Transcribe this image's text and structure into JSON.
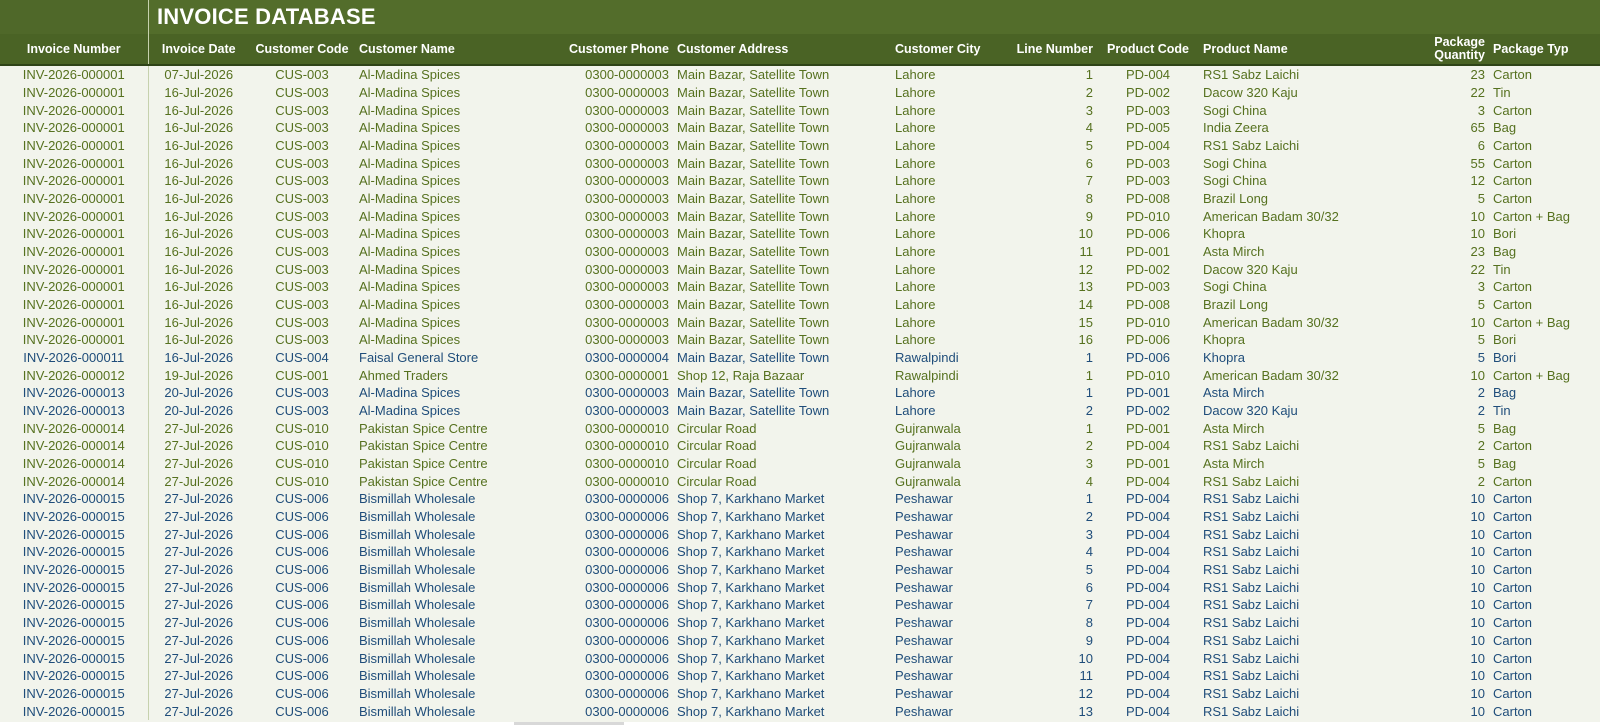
{
  "sheet": {
    "title": "INVOICE DATABASE"
  },
  "colors": {
    "header_bg": "#4a6325",
    "title_bg": "#536d2b",
    "row_green": "#56711f",
    "row_blue": "#1f4d7a",
    "sheet_bg": "#f2f4ec"
  },
  "columns": [
    "Invoice Number",
    "Invoice Date",
    "Customer Code",
    "Customer Name",
    "Customer Phone",
    "Customer Address",
    "Customer City",
    "Line Number",
    "Product Code",
    "Product Name",
    "Package Quantity",
    "Package Typ"
  ],
  "rows": [
    {
      "inv": "INV-2026-000001",
      "date": "07-Jul-2026",
      "code": "CUS-003",
      "name": "Al-Madina Spices",
      "phone": "0300-0000003",
      "address": "Main Bazar, Satellite Town",
      "city": "Lahore",
      "line": "1",
      "pcode": "PD-004",
      "pname": "RS1 Sabz Laichi",
      "qty": "23",
      "ptype": "Carton",
      "color": "green"
    },
    {
      "inv": "INV-2026-000001",
      "date": "16-Jul-2026",
      "code": "CUS-003",
      "name": "Al-Madina Spices",
      "phone": "0300-0000003",
      "address": "Main Bazar, Satellite Town",
      "city": "Lahore",
      "line": "2",
      "pcode": "PD-002",
      "pname": "Dacow 320 Kaju",
      "qty": "22",
      "ptype": "Tin",
      "color": "green"
    },
    {
      "inv": "INV-2026-000001",
      "date": "16-Jul-2026",
      "code": "CUS-003",
      "name": "Al-Madina Spices",
      "phone": "0300-0000003",
      "address": "Main Bazar, Satellite Town",
      "city": "Lahore",
      "line": "3",
      "pcode": "PD-003",
      "pname": "Sogi China",
      "qty": "3",
      "ptype": "Carton",
      "color": "green"
    },
    {
      "inv": "INV-2026-000001",
      "date": "16-Jul-2026",
      "code": "CUS-003",
      "name": "Al-Madina Spices",
      "phone": "0300-0000003",
      "address": "Main Bazar, Satellite Town",
      "city": "Lahore",
      "line": "4",
      "pcode": "PD-005",
      "pname": "India Zeera",
      "qty": "65",
      "ptype": "Bag",
      "color": "green"
    },
    {
      "inv": "INV-2026-000001",
      "date": "16-Jul-2026",
      "code": "CUS-003",
      "name": "Al-Madina Spices",
      "phone": "0300-0000003",
      "address": "Main Bazar, Satellite Town",
      "city": "Lahore",
      "line": "5",
      "pcode": "PD-004",
      "pname": "RS1 Sabz Laichi",
      "qty": "6",
      "ptype": "Carton",
      "color": "green"
    },
    {
      "inv": "INV-2026-000001",
      "date": "16-Jul-2026",
      "code": "CUS-003",
      "name": "Al-Madina Spices",
      "phone": "0300-0000003",
      "address": "Main Bazar, Satellite Town",
      "city": "Lahore",
      "line": "6",
      "pcode": "PD-003",
      "pname": "Sogi China",
      "qty": "55",
      "ptype": "Carton",
      "color": "green"
    },
    {
      "inv": "INV-2026-000001",
      "date": "16-Jul-2026",
      "code": "CUS-003",
      "name": "Al-Madina Spices",
      "phone": "0300-0000003",
      "address": "Main Bazar, Satellite Town",
      "city": "Lahore",
      "line": "7",
      "pcode": "PD-003",
      "pname": "Sogi China",
      "qty": "12",
      "ptype": "Carton",
      "color": "green"
    },
    {
      "inv": "INV-2026-000001",
      "date": "16-Jul-2026",
      "code": "CUS-003",
      "name": "Al-Madina Spices",
      "phone": "0300-0000003",
      "address": "Main Bazar, Satellite Town",
      "city": "Lahore",
      "line": "8",
      "pcode": "PD-008",
      "pname": "Brazil Long",
      "qty": "5",
      "ptype": "Carton",
      "color": "green"
    },
    {
      "inv": "INV-2026-000001",
      "date": "16-Jul-2026",
      "code": "CUS-003",
      "name": "Al-Madina Spices",
      "phone": "0300-0000003",
      "address": "Main Bazar, Satellite Town",
      "city": "Lahore",
      "line": "9",
      "pcode": "PD-010",
      "pname": "American Badam 30/32",
      "qty": "10",
      "ptype": "Carton + Bag",
      "color": "green"
    },
    {
      "inv": "INV-2026-000001",
      "date": "16-Jul-2026",
      "code": "CUS-003",
      "name": "Al-Madina Spices",
      "phone": "0300-0000003",
      "address": "Main Bazar, Satellite Town",
      "city": "Lahore",
      "line": "10",
      "pcode": "PD-006",
      "pname": "Khopra",
      "qty": "10",
      "ptype": "Bori",
      "color": "green"
    },
    {
      "inv": "INV-2026-000001",
      "date": "16-Jul-2026",
      "code": "CUS-003",
      "name": "Al-Madina Spices",
      "phone": "0300-0000003",
      "address": "Main Bazar, Satellite Town",
      "city": "Lahore",
      "line": "11",
      "pcode": "PD-001",
      "pname": "Asta Mirch",
      "qty": "23",
      "ptype": "Bag",
      "color": "green"
    },
    {
      "inv": "INV-2026-000001",
      "date": "16-Jul-2026",
      "code": "CUS-003",
      "name": "Al-Madina Spices",
      "phone": "0300-0000003",
      "address": "Main Bazar, Satellite Town",
      "city": "Lahore",
      "line": "12",
      "pcode": "PD-002",
      "pname": "Dacow 320 Kaju",
      "qty": "22",
      "ptype": "Tin",
      "color": "green"
    },
    {
      "inv": "INV-2026-000001",
      "date": "16-Jul-2026",
      "code": "CUS-003",
      "name": "Al-Madina Spices",
      "phone": "0300-0000003",
      "address": "Main Bazar, Satellite Town",
      "city": "Lahore",
      "line": "13",
      "pcode": "PD-003",
      "pname": "Sogi China",
      "qty": "3",
      "ptype": "Carton",
      "color": "green"
    },
    {
      "inv": "INV-2026-000001",
      "date": "16-Jul-2026",
      "code": "CUS-003",
      "name": "Al-Madina Spices",
      "phone": "0300-0000003",
      "address": "Main Bazar, Satellite Town",
      "city": "Lahore",
      "line": "14",
      "pcode": "PD-008",
      "pname": "Brazil Long",
      "qty": "5",
      "ptype": "Carton",
      "color": "green"
    },
    {
      "inv": "INV-2026-000001",
      "date": "16-Jul-2026",
      "code": "CUS-003",
      "name": "Al-Madina Spices",
      "phone": "0300-0000003",
      "address": "Main Bazar, Satellite Town",
      "city": "Lahore",
      "line": "15",
      "pcode": "PD-010",
      "pname": "American Badam 30/32",
      "qty": "10",
      "ptype": "Carton + Bag",
      "color": "green"
    },
    {
      "inv": "INV-2026-000001",
      "date": "16-Jul-2026",
      "code": "CUS-003",
      "name": "Al-Madina Spices",
      "phone": "0300-0000003",
      "address": "Main Bazar, Satellite Town",
      "city": "Lahore",
      "line": "16",
      "pcode": "PD-006",
      "pname": "Khopra",
      "qty": "5",
      "ptype": "Bori",
      "color": "green"
    },
    {
      "inv": "INV-2026-000011",
      "date": "16-Jul-2026",
      "code": "CUS-004",
      "name": "Faisal General Store",
      "phone": "0300-0000004",
      "address": "Main Bazar, Satellite Town",
      "city": "Rawalpindi",
      "line": "1",
      "pcode": "PD-006",
      "pname": "Khopra",
      "qty": "5",
      "ptype": "Bori",
      "color": "blue"
    },
    {
      "inv": "INV-2026-000012",
      "date": "19-Jul-2026",
      "code": "CUS-001",
      "name": "Ahmed Traders",
      "phone": "0300-0000001",
      "address": "Shop 12, Raja Bazaar",
      "city": "Rawalpindi",
      "line": "1",
      "pcode": "PD-010",
      "pname": "American Badam 30/32",
      "qty": "10",
      "ptype": "Carton + Bag",
      "color": "green"
    },
    {
      "inv": "INV-2026-000013",
      "date": "20-Jul-2026",
      "code": "CUS-003",
      "name": "Al-Madina Spices",
      "phone": "0300-0000003",
      "address": "Main Bazar, Satellite Town",
      "city": "Lahore",
      "line": "1",
      "pcode": "PD-001",
      "pname": "Asta Mirch",
      "qty": "2",
      "ptype": "Bag",
      "color": "blue"
    },
    {
      "inv": "INV-2026-000013",
      "date": "20-Jul-2026",
      "code": "CUS-003",
      "name": "Al-Madina Spices",
      "phone": "0300-0000003",
      "address": "Main Bazar, Satellite Town",
      "city": "Lahore",
      "line": "2",
      "pcode": "PD-002",
      "pname": "Dacow 320 Kaju",
      "qty": "2",
      "ptype": "Tin",
      "color": "blue"
    },
    {
      "inv": "INV-2026-000014",
      "date": "27-Jul-2026",
      "code": "CUS-010",
      "name": "Pakistan Spice Centre",
      "phone": "0300-0000010",
      "address": "Circular Road",
      "city": "Gujranwala",
      "line": "1",
      "pcode": "PD-001",
      "pname": "Asta Mirch",
      "qty": "5",
      "ptype": "Bag",
      "color": "green"
    },
    {
      "inv": "INV-2026-000014",
      "date": "27-Jul-2026",
      "code": "CUS-010",
      "name": "Pakistan Spice Centre",
      "phone": "0300-0000010",
      "address": "Circular Road",
      "city": "Gujranwala",
      "line": "2",
      "pcode": "PD-004",
      "pname": "RS1 Sabz Laichi",
      "qty": "2",
      "ptype": "Carton",
      "color": "green"
    },
    {
      "inv": "INV-2026-000014",
      "date": "27-Jul-2026",
      "code": "CUS-010",
      "name": "Pakistan Spice Centre",
      "phone": "0300-0000010",
      "address": "Circular Road",
      "city": "Gujranwala",
      "line": "3",
      "pcode": "PD-001",
      "pname": "Asta Mirch",
      "qty": "5",
      "ptype": "Bag",
      "color": "green"
    },
    {
      "inv": "INV-2026-000014",
      "date": "27-Jul-2026",
      "code": "CUS-010",
      "name": "Pakistan Spice Centre",
      "phone": "0300-0000010",
      "address": "Circular Road",
      "city": "Gujranwala",
      "line": "4",
      "pcode": "PD-004",
      "pname": "RS1 Sabz Laichi",
      "qty": "2",
      "ptype": "Carton",
      "color": "green"
    },
    {
      "inv": "INV-2026-000015",
      "date": "27-Jul-2026",
      "code": "CUS-006",
      "name": "Bismillah Wholesale",
      "phone": "0300-0000006",
      "address": "Shop 7, Karkhano Market",
      "city": "Peshawar",
      "line": "1",
      "pcode": "PD-004",
      "pname": "RS1 Sabz Laichi",
      "qty": "10",
      "ptype": "Carton",
      "color": "blue"
    },
    {
      "inv": "INV-2026-000015",
      "date": "27-Jul-2026",
      "code": "CUS-006",
      "name": "Bismillah Wholesale",
      "phone": "0300-0000006",
      "address": "Shop 7, Karkhano Market",
      "city": "Peshawar",
      "line": "2",
      "pcode": "PD-004",
      "pname": "RS1 Sabz Laichi",
      "qty": "10",
      "ptype": "Carton",
      "color": "blue"
    },
    {
      "inv": "INV-2026-000015",
      "date": "27-Jul-2026",
      "code": "CUS-006",
      "name": "Bismillah Wholesale",
      "phone": "0300-0000006",
      "address": "Shop 7, Karkhano Market",
      "city": "Peshawar",
      "line": "3",
      "pcode": "PD-004",
      "pname": "RS1 Sabz Laichi",
      "qty": "10",
      "ptype": "Carton",
      "color": "blue"
    },
    {
      "inv": "INV-2026-000015",
      "date": "27-Jul-2026",
      "code": "CUS-006",
      "name": "Bismillah Wholesale",
      "phone": "0300-0000006",
      "address": "Shop 7, Karkhano Market",
      "city": "Peshawar",
      "line": "4",
      "pcode": "PD-004",
      "pname": "RS1 Sabz Laichi",
      "qty": "10",
      "ptype": "Carton",
      "color": "blue"
    },
    {
      "inv": "INV-2026-000015",
      "date": "27-Jul-2026",
      "code": "CUS-006",
      "name": "Bismillah Wholesale",
      "phone": "0300-0000006",
      "address": "Shop 7, Karkhano Market",
      "city": "Peshawar",
      "line": "5",
      "pcode": "PD-004",
      "pname": "RS1 Sabz Laichi",
      "qty": "10",
      "ptype": "Carton",
      "color": "blue"
    },
    {
      "inv": "INV-2026-000015",
      "date": "27-Jul-2026",
      "code": "CUS-006",
      "name": "Bismillah Wholesale",
      "phone": "0300-0000006",
      "address": "Shop 7, Karkhano Market",
      "city": "Peshawar",
      "line": "6",
      "pcode": "PD-004",
      "pname": "RS1 Sabz Laichi",
      "qty": "10",
      "ptype": "Carton",
      "color": "blue"
    },
    {
      "inv": "INV-2026-000015",
      "date": "27-Jul-2026",
      "code": "CUS-006",
      "name": "Bismillah Wholesale",
      "phone": "0300-0000006",
      "address": "Shop 7, Karkhano Market",
      "city": "Peshawar",
      "line": "7",
      "pcode": "PD-004",
      "pname": "RS1 Sabz Laichi",
      "qty": "10",
      "ptype": "Carton",
      "color": "blue"
    },
    {
      "inv": "INV-2026-000015",
      "date": "27-Jul-2026",
      "code": "CUS-006",
      "name": "Bismillah Wholesale",
      "phone": "0300-0000006",
      "address": "Shop 7, Karkhano Market",
      "city": "Peshawar",
      "line": "8",
      "pcode": "PD-004",
      "pname": "RS1 Sabz Laichi",
      "qty": "10",
      "ptype": "Carton",
      "color": "blue"
    },
    {
      "inv": "INV-2026-000015",
      "date": "27-Jul-2026",
      "code": "CUS-006",
      "name": "Bismillah Wholesale",
      "phone": "0300-0000006",
      "address": "Shop 7, Karkhano Market",
      "city": "Peshawar",
      "line": "9",
      "pcode": "PD-004",
      "pname": "RS1 Sabz Laichi",
      "qty": "10",
      "ptype": "Carton",
      "color": "blue"
    },
    {
      "inv": "INV-2026-000015",
      "date": "27-Jul-2026",
      "code": "CUS-006",
      "name": "Bismillah Wholesale",
      "phone": "0300-0000006",
      "address": "Shop 7, Karkhano Market",
      "city": "Peshawar",
      "line": "10",
      "pcode": "PD-004",
      "pname": "RS1 Sabz Laichi",
      "qty": "10",
      "ptype": "Carton",
      "color": "blue"
    },
    {
      "inv": "INV-2026-000015",
      "date": "27-Jul-2026",
      "code": "CUS-006",
      "name": "Bismillah Wholesale",
      "phone": "0300-0000006",
      "address": "Shop 7, Karkhano Market",
      "city": "Peshawar",
      "line": "11",
      "pcode": "PD-004",
      "pname": "RS1 Sabz Laichi",
      "qty": "10",
      "ptype": "Carton",
      "color": "blue"
    },
    {
      "inv": "INV-2026-000015",
      "date": "27-Jul-2026",
      "code": "CUS-006",
      "name": "Bismillah Wholesale",
      "phone": "0300-0000006",
      "address": "Shop 7, Karkhano Market",
      "city": "Peshawar",
      "line": "12",
      "pcode": "PD-004",
      "pname": "RS1 Sabz Laichi",
      "qty": "10",
      "ptype": "Carton",
      "color": "blue"
    },
    {
      "inv": "INV-2026-000015",
      "date": "27-Jul-2026",
      "code": "CUS-006",
      "name": "Bismillah Wholesale",
      "phone": "0300-0000006",
      "address": "Shop 7, Karkhano Market",
      "city": "Peshawar",
      "line": "13",
      "pcode": "PD-004",
      "pname": "RS1 Sabz Laichi",
      "qty": "10",
      "ptype": "Carton",
      "color": "blue"
    }
  ]
}
